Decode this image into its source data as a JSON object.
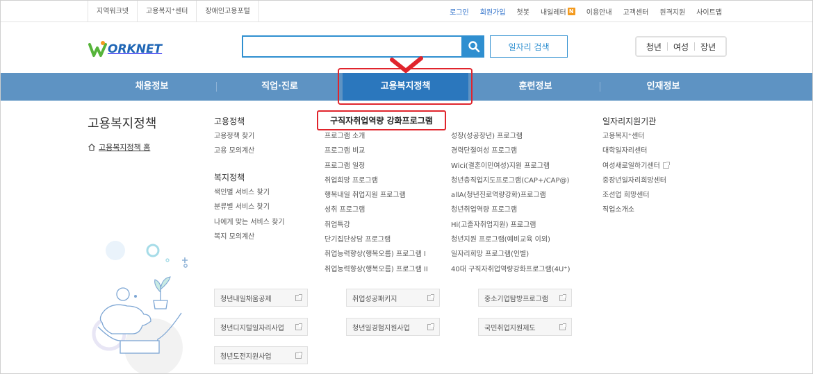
{
  "util": {
    "left": [
      "지역워크넷",
      "고용복지⁺센터",
      "장애인고용포털"
    ],
    "right": [
      {
        "label": "로그인",
        "blue": true
      },
      {
        "label": "회원가입",
        "blue": true
      },
      {
        "label": "첫봇",
        "blue": false
      },
      {
        "label": "내일레터",
        "blue": false,
        "badge": "N"
      },
      {
        "label": "이용안내",
        "blue": false
      },
      {
        "label": "고객센터",
        "blue": false
      },
      {
        "label": "원격지원",
        "blue": false
      },
      {
        "label": "사이트맵",
        "blue": false
      }
    ]
  },
  "header": {
    "logo_text": "ORKNET",
    "search_placeholder": "",
    "job_search_label": "일자리 검색",
    "target_tabs": [
      "청년",
      "여성",
      "장년"
    ]
  },
  "gnb": {
    "items": [
      "채용정보",
      "직업·진로",
      "고용복지정책",
      "훈련정보",
      "인재정보"
    ],
    "active_index": 2
  },
  "submenu": {
    "section_title": "고용복지정책",
    "home_link": "고용복지정책 홈",
    "col1": {
      "head1": "고용정책",
      "items1": [
        "고용정책 찾기",
        "고용 모의계산"
      ],
      "head2": "복지정책",
      "items2": [
        "색인별 서비스 찾기",
        "분류별 서비스 찾기",
        "나에게 맞는 서비스 찾기",
        "복지 모의계산"
      ]
    },
    "col2": {
      "head": "구직자취업역량 강화프로그램",
      "items": [
        "프로그램 소개",
        "프로그램 비교",
        "프로그램 일정",
        "취업희망 프로그램",
        "행복내일 취업지원 프로그램",
        "성취 프로그램",
        "취업특강",
        "단기집단상담 프로그램",
        "취업능력향상(행복오름) 프로그램 I",
        "취업능력향상(행복오름) 프로그램 II"
      ]
    },
    "col3": {
      "items": [
        "성장(성공장년) 프로그램",
        "경력단절여성 프로그램",
        "Wici(결혼이민여성)지원 프로그램",
        "청년층직업지도프로그램(CAP+/CAP@)",
        "allA(청년진로역량강화)프로그램",
        "청년취업역량 프로그램",
        "Hi(고졸자취업지원) 프로그램",
        "청년지원 프로그램(예비교육 이외)",
        "일자리희망 프로그램(인별)",
        "40대 구직자취업역량강화프로그램(4U⁺)"
      ]
    },
    "col4": {
      "head": "일자리지원기관",
      "items": [
        {
          "label": "고용복지⁺센터",
          "ext": false
        },
        {
          "label": "대학일자리센터",
          "ext": false
        },
        {
          "label": "여성새로일하기센터",
          "ext": true
        },
        {
          "label": "중장년일자리희망센터",
          "ext": false
        },
        {
          "label": "조선업 희망센터",
          "ext": false
        },
        {
          "label": "직업소개소",
          "ext": false
        }
      ]
    },
    "link_boxes": [
      "청년내일채움공제",
      "취업성공패키지",
      "중소기업탐방프로그램",
      "청년디지털일자리사업",
      "청년일경험지원사업",
      "국민취업지원제도",
      "청년도전지원사업"
    ]
  },
  "colors": {
    "gnb_bg": "#5e93c3",
    "gnb_active": "#2b77bd",
    "accent": "#2f8fd0",
    "highlight": "#e0242c"
  }
}
